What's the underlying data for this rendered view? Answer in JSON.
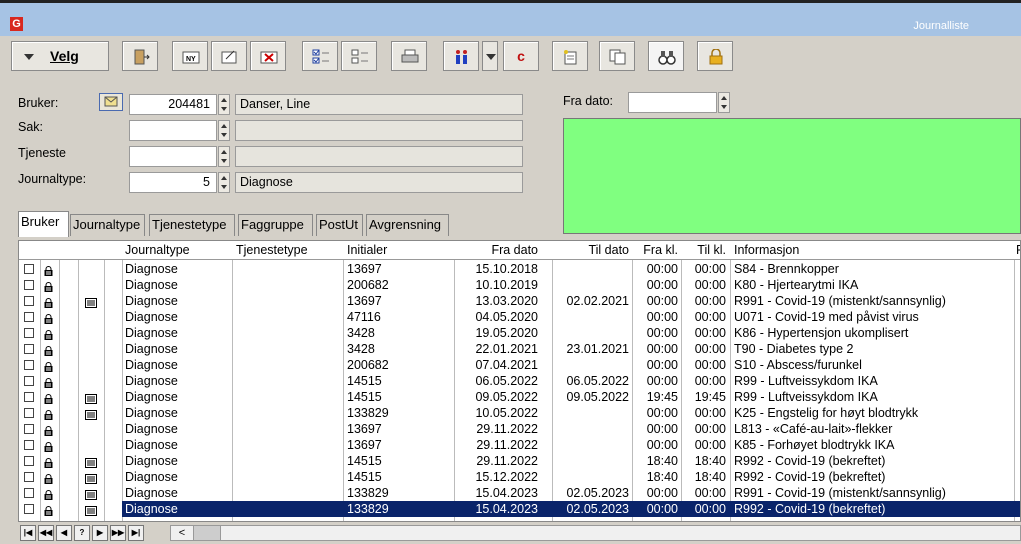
{
  "window": {
    "title": "Journalliste",
    "logo": "G"
  },
  "toolbar": {
    "velg_label": "Velg",
    "c_label": "c"
  },
  "form": {
    "bruker_label": "Bruker:",
    "bruker_value": "204481",
    "bruker_name": "Danser, Line",
    "sak_label": "Sak:",
    "sak_value": "",
    "sak_name": "",
    "tjeneste_label": "Tjeneste",
    "tjeneste_value": "",
    "tjeneste_name": "",
    "journaltype_label": "Journaltype:",
    "journaltype_value": "5",
    "journaltype_name": "Diagnose",
    "fra_dato_label": "Fra dato:",
    "fra_dato_value": ""
  },
  "tabs": [
    "Bruker",
    "Journaltype",
    "Tjenestetype",
    "Faggruppe",
    "PostUt",
    "Avgrensning"
  ],
  "columns": [
    "Journaltype",
    "Tjenestetype",
    "Initialer",
    "Fra dato",
    "Til dato",
    "Fra kl.",
    "Til kl.",
    "Informasjon",
    "F"
  ],
  "rows": [
    {
      "note": false,
      "type": "Diagnose",
      "tj": "",
      "init": "13697",
      "fra": "15.10.2018",
      "til": "",
      "fkl": "00:00",
      "tkl": "00:00",
      "info": "S84 - Brennkopper"
    },
    {
      "note": false,
      "type": "Diagnose",
      "tj": "",
      "init": "200682",
      "fra": "10.10.2019",
      "til": "",
      "fkl": "00:00",
      "tkl": "00:00",
      "info": "K80 - Hjertearytmi IKA"
    },
    {
      "note": true,
      "type": "Diagnose",
      "tj": "",
      "init": "13697",
      "fra": "13.03.2020",
      "til": "02.02.2021",
      "fkl": "00:00",
      "tkl": "00:00",
      "info": "R991 - Covid-19 (mistenkt/sannsynlig)"
    },
    {
      "note": false,
      "type": "Diagnose",
      "tj": "",
      "init": "47116",
      "fra": "04.05.2020",
      "til": "",
      "fkl": "00:00",
      "tkl": "00:00",
      "info": "U071 - Covid-19 med påvist virus"
    },
    {
      "note": false,
      "type": "Diagnose",
      "tj": "",
      "init": "3428",
      "fra": "19.05.2020",
      "til": "",
      "fkl": "00:00",
      "tkl": "00:00",
      "info": "K86 - Hypertensjon ukomplisert"
    },
    {
      "note": false,
      "type": "Diagnose",
      "tj": "",
      "init": "3428",
      "fra": "22.01.2021",
      "til": "23.01.2021",
      "fkl": "00:00",
      "tkl": "00:00",
      "info": "T90 - Diabetes type 2"
    },
    {
      "note": false,
      "type": "Diagnose",
      "tj": "",
      "init": "200682",
      "fra": "07.04.2021",
      "til": "",
      "fkl": "00:00",
      "tkl": "00:00",
      "info": "S10 - Abscess/furunkel"
    },
    {
      "note": false,
      "type": "Diagnose",
      "tj": "",
      "init": "14515",
      "fra": "06.05.2022",
      "til": "06.05.2022",
      "fkl": "00:00",
      "tkl": "00:00",
      "info": "R99 - Luftveissykdom IKA"
    },
    {
      "note": true,
      "type": "Diagnose",
      "tj": "",
      "init": "14515",
      "fra": "09.05.2022",
      "til": "09.05.2022",
      "fkl": "19:45",
      "tkl": "19:45",
      "info": "R99 - Luftveissykdom IKA"
    },
    {
      "note": true,
      "type": "Diagnose",
      "tj": "",
      "init": "133829",
      "fra": "10.05.2022",
      "til": "",
      "fkl": "00:00",
      "tkl": "00:00",
      "info": "K25 - Engstelig for høyt blodtrykk"
    },
    {
      "note": false,
      "type": "Diagnose",
      "tj": "",
      "init": "13697",
      "fra": "29.11.2022",
      "til": "",
      "fkl": "00:00",
      "tkl": "00:00",
      "info": "L813 - «Café-au-lait»-flekker"
    },
    {
      "note": false,
      "type": "Diagnose",
      "tj": "",
      "init": "13697",
      "fra": "29.11.2022",
      "til": "",
      "fkl": "00:00",
      "tkl": "00:00",
      "info": "K85 - Forhøyet blodtrykk IKA"
    },
    {
      "note": true,
      "type": "Diagnose",
      "tj": "",
      "init": "14515",
      "fra": "29.11.2022",
      "til": "",
      "fkl": "18:40",
      "tkl": "18:40",
      "info": "R992 - Covid-19 (bekreftet)"
    },
    {
      "note": true,
      "type": "Diagnose",
      "tj": "",
      "init": "14515",
      "fra": "15.12.2022",
      "til": "",
      "fkl": "18:40",
      "tkl": "18:40",
      "info": "R992 - Covid-19 (bekreftet)"
    },
    {
      "note": true,
      "type": "Diagnose",
      "tj": "",
      "init": "133829",
      "fra": "15.04.2023",
      "til": "02.05.2023",
      "fkl": "00:00",
      "tkl": "00:00",
      "info": "R991 - Covid-19 (mistenkt/sannsynlig)"
    },
    {
      "note": true,
      "type": "Diagnose",
      "tj": "",
      "init": "133829",
      "fra": "15.04.2023",
      "til": "02.05.2023",
      "fkl": "00:00",
      "tkl": "00:00",
      "info": "R992 - Covid-19 (bekreftet)",
      "selected": true
    }
  ],
  "nav": {
    "buttons": [
      "|◀",
      "◀◀",
      "◀",
      "?",
      "▶",
      "▶▶",
      "▶|"
    ],
    "scroll_left": "<"
  },
  "colors": {
    "selection": "#0a246a",
    "green_panel": "#80ff80",
    "titlebar": "#a6c3e4"
  }
}
